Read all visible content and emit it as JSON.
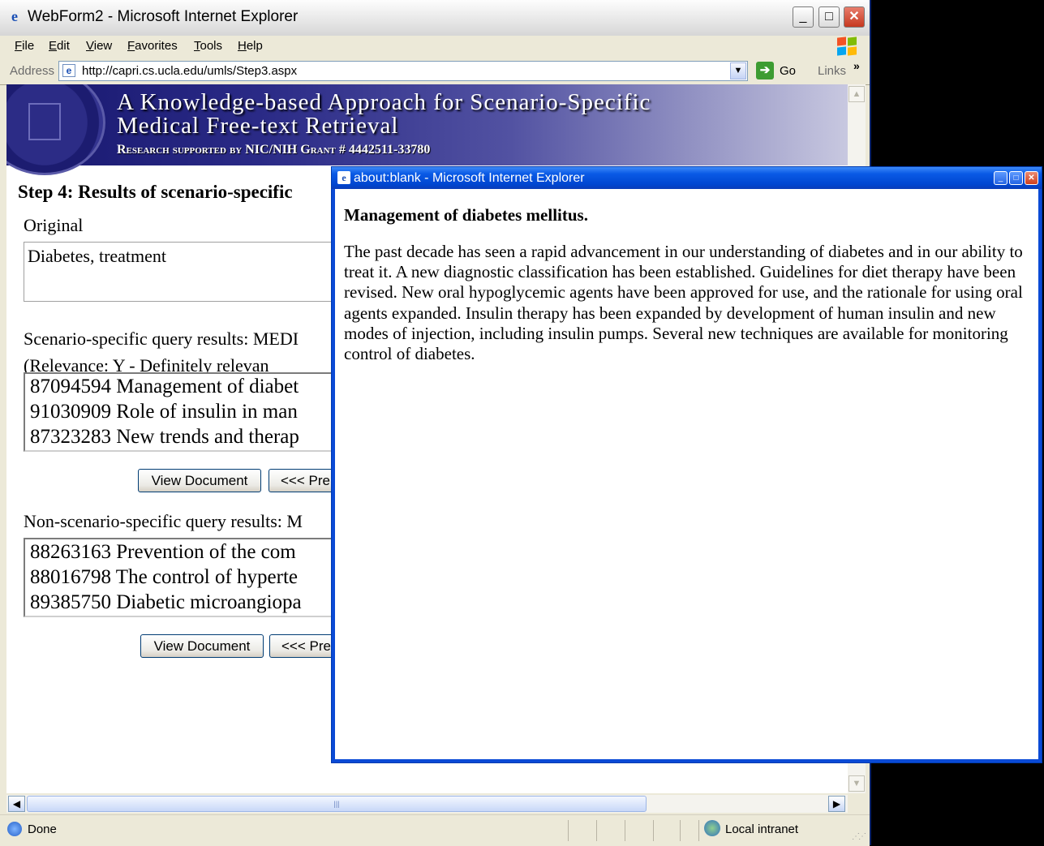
{
  "main_window": {
    "title": "WebForm2 - Microsoft Internet Explorer",
    "menu": [
      "File",
      "Edit",
      "View",
      "Favorites",
      "Tools",
      "Help"
    ],
    "address_label": "Address",
    "url": "http://capri.cs.ucla.edu/umls/Step3.aspx",
    "go_label": "Go",
    "links_label": "Links",
    "status_text": "Done",
    "zone": "Local intranet"
  },
  "banner": {
    "line1": "A Knowledge-based Approach for Scenario-Specific",
    "line2": "Medical Free-text Retrieval",
    "line3": "Research supported by NIC/NIH Grant # 4442511-33780"
  },
  "page": {
    "step_title": "Step 4: Results of scenario-specific",
    "original_label": "Original",
    "original_value": "Diabetes, treatment",
    "scenario_label": "Scenario-specific query results: MEDI",
    "relevance_label": "(Relevance: Y - Definitely relevan",
    "scenario_results": [
      "87094594 Management of diabet",
      "91030909 Role of insulin in man",
      "87323283 New trends and therap"
    ],
    "view_document": "View Document",
    "prev_label": "<<< Pre",
    "nonscenario_label": "Non-scenario-specific query results: M",
    "nonscenario_results": [
      "88263163 Prevention of the com",
      "88016798 The control of hyperte",
      "89385750 Diabetic microangiopa"
    ]
  },
  "popup": {
    "title": "about:blank - Microsoft Internet Explorer",
    "heading": "Management of diabetes mellitus.",
    "body": "The past decade has seen a rapid advancement in our understanding of diabetes and in our ability to treat it. A new diagnostic classification has been established. Guidelines for diet therapy have been revised. New oral hypoglycemic agents have been approved for use, and the rationale for using oral agents expanded. Insulin therapy has been expanded by development of human insulin and new modes of injection, including insulin pumps. Several new techniques are available for monitoring control of diabetes."
  }
}
